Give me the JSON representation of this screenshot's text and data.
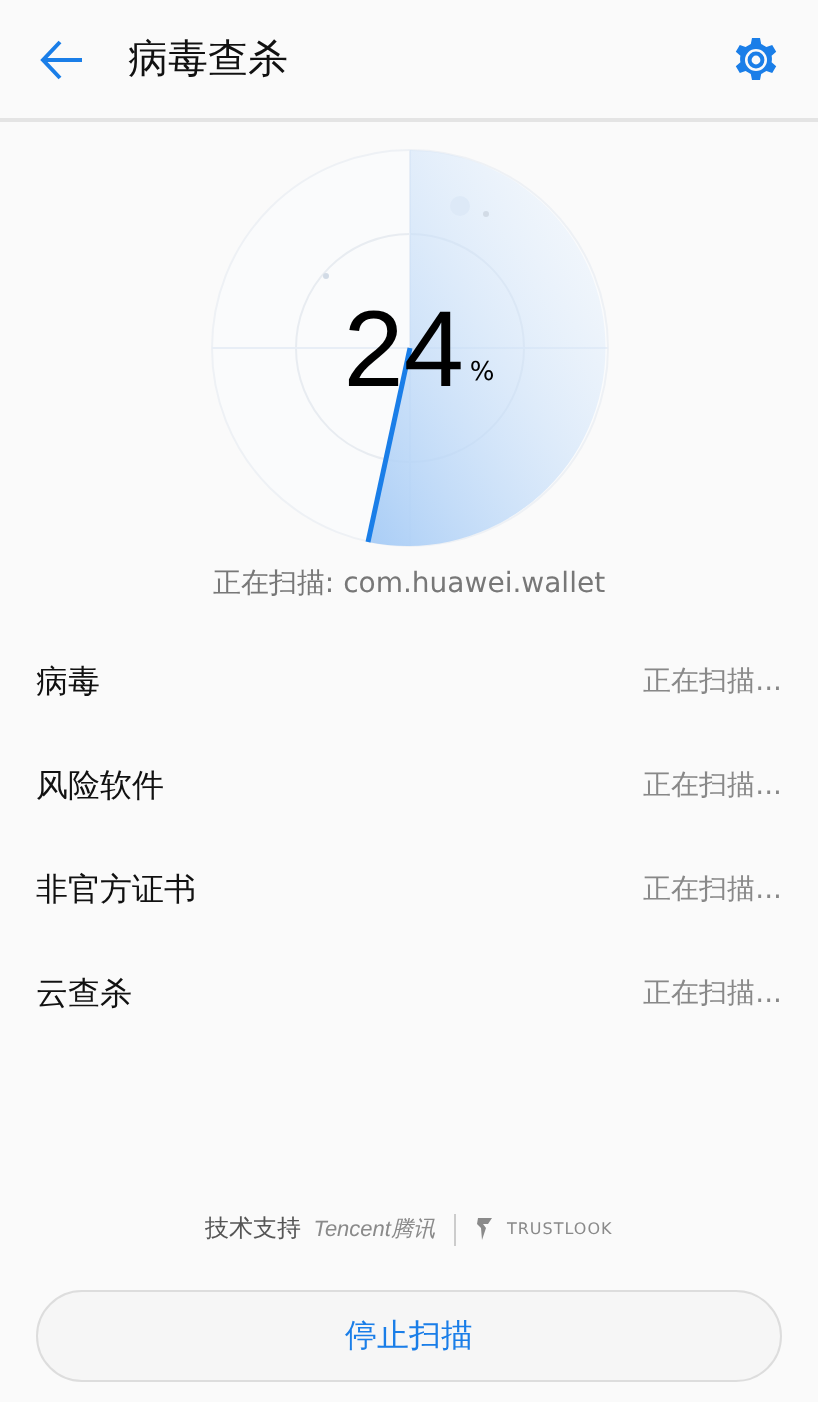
{
  "header": {
    "title": "病毒查杀"
  },
  "scan": {
    "percent": "24",
    "unit": "%",
    "current": "正在扫描: com.huawei.wallet"
  },
  "items": [
    {
      "label": "病毒",
      "status": "正在扫描..."
    },
    {
      "label": "风险软件",
      "status": "正在扫描..."
    },
    {
      "label": "非官方证书",
      "status": "正在扫描..."
    },
    {
      "label": "云查杀",
      "status": "正在扫描..."
    }
  ],
  "footer": {
    "support": "技术支持",
    "partners": [
      "Tencent腾讯",
      "TRUSTLOOK"
    ]
  },
  "button": "停止扫描"
}
